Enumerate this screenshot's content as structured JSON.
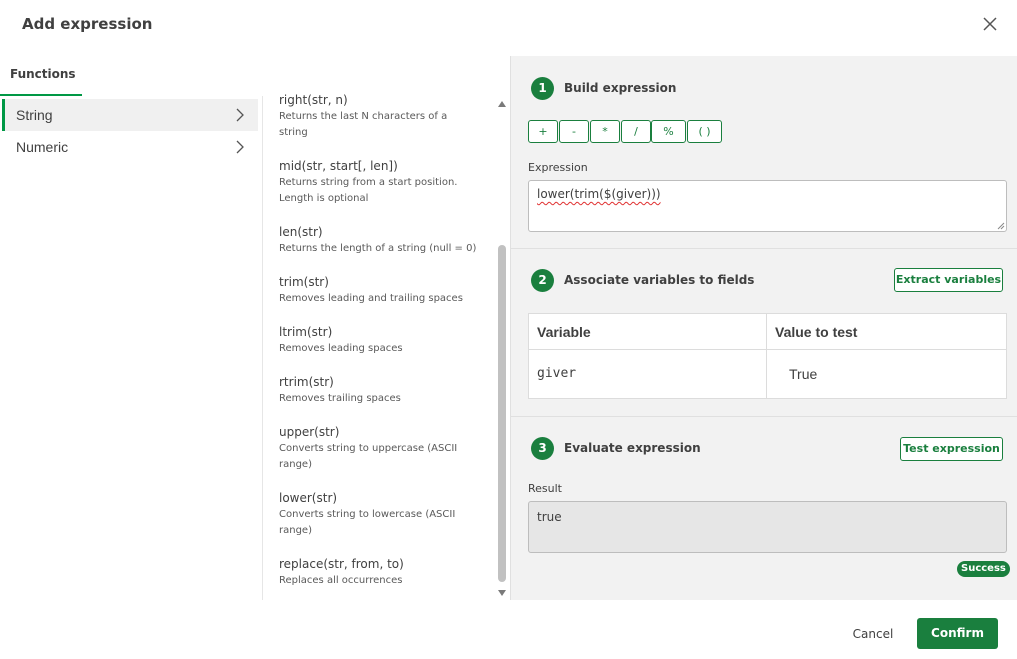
{
  "dialog": {
    "title": "Add expression",
    "close_icon": "close-icon"
  },
  "left": {
    "tab_label": "Functions",
    "categories": [
      {
        "label": "String",
        "active": true
      },
      {
        "label": "Numeric",
        "active": false
      }
    ]
  },
  "functions": [
    {
      "name": "right(str, n)",
      "desc_lines": [
        "Returns the last N characters of a",
        "string"
      ]
    },
    {
      "name": "mid(str, start[, len])",
      "desc_lines": [
        "Returns string from a start position.",
        "Length is optional"
      ]
    },
    {
      "name": "len(str)",
      "desc_lines": [
        "Returns the length of a string (null = 0)"
      ]
    },
    {
      "name": "trim(str)",
      "desc_lines": [
        "Removes leading and trailing spaces"
      ]
    },
    {
      "name": "ltrim(str)",
      "desc_lines": [
        "Removes leading spaces"
      ]
    },
    {
      "name": "rtrim(str)",
      "desc_lines": [
        "Removes trailing spaces"
      ]
    },
    {
      "name": "upper(str)",
      "desc_lines": [
        "Converts string to uppercase (ASCII",
        "range)"
      ]
    },
    {
      "name": "lower(str)",
      "desc_lines": [
        "Converts string to lowercase (ASCII",
        "range)"
      ]
    },
    {
      "name": "replace(str, from, to)",
      "desc_lines": [
        "Replaces all occurrences"
      ]
    }
  ],
  "build": {
    "step": "1",
    "title": "Build expression",
    "operators": [
      "+",
      "-",
      "*",
      "/",
      "%",
      "( )"
    ],
    "expression_label": "Expression",
    "expression_value": "lower(trim($(giver)))"
  },
  "associate": {
    "step": "2",
    "title": "Associate variables to fields",
    "extract_button": "Extract variables",
    "columns": [
      "Variable",
      "Value to test"
    ],
    "rows": [
      {
        "variable": "giver",
        "value": "True"
      }
    ]
  },
  "evaluate": {
    "step": "3",
    "title": "Evaluate expression",
    "test_button": "Test expression",
    "result_label": "Result",
    "result_value": "true",
    "status": "Success"
  },
  "footer": {
    "cancel_label": "Cancel",
    "confirm_label": "Confirm"
  },
  "colors": {
    "accent": "#1a7f3e",
    "panel_bg": "#f2f2f2"
  }
}
